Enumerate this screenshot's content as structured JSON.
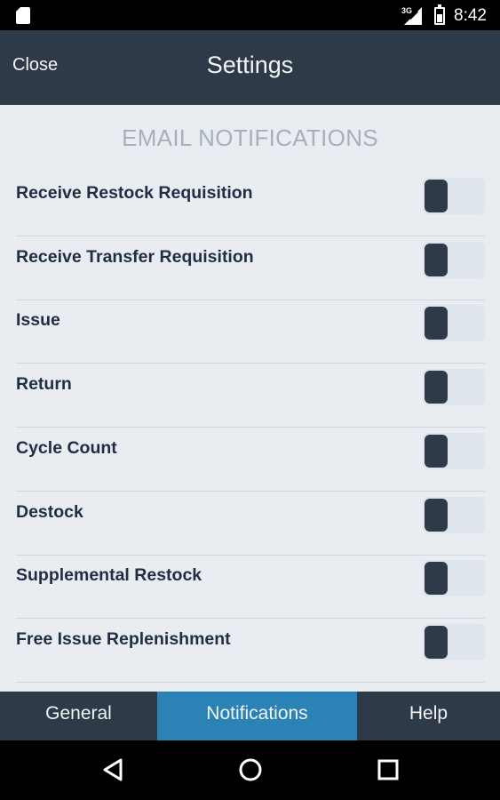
{
  "status_bar": {
    "network": "3G",
    "time": "8:42"
  },
  "header": {
    "close_label": "Close",
    "title": "Settings"
  },
  "section": {
    "heading": "EMAIL NOTIFICATIONS"
  },
  "settings": [
    {
      "label": "Receive Restock Requisition",
      "enabled": false
    },
    {
      "label": "Receive Transfer Requisition",
      "enabled": false
    },
    {
      "label": "Issue",
      "enabled": false
    },
    {
      "label": "Return",
      "enabled": false
    },
    {
      "label": "Cycle Count",
      "enabled": false
    },
    {
      "label": "Destock",
      "enabled": false
    },
    {
      "label": "Supplemental Restock",
      "enabled": false
    },
    {
      "label": "Free Issue Replenishment",
      "enabled": false
    }
  ],
  "tabs": [
    {
      "label": "General",
      "active": false
    },
    {
      "label": "Notifications",
      "active": true
    },
    {
      "label": "Help",
      "active": false
    }
  ],
  "nav": {
    "back": "back-icon",
    "home": "home-icon",
    "recents": "recents-icon"
  },
  "colors": {
    "header_bg": "#2f3a48",
    "content_bg": "#e9edf1",
    "active_tab": "#2b82b5",
    "label_text": "#1f2e45",
    "heading_text": "#a6b0bc"
  }
}
